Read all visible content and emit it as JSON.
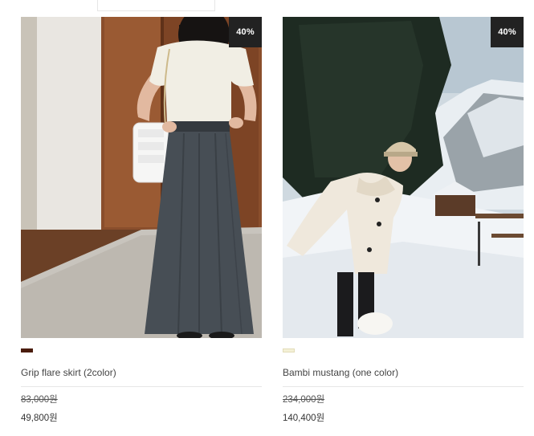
{
  "products": [
    {
      "name": "Grip flare skirt (2color)",
      "discount": "40%",
      "price_original": "83,000원",
      "price_sale": "49,800원",
      "swatch_color": "#4a1c0c",
      "image_desc": "skirt-photo"
    },
    {
      "name": "Bambi mustang (one color)",
      "discount": "40%",
      "price_original": "234,000원",
      "price_sale": "140,400원",
      "swatch_color": "#f4f0d6",
      "image_desc": "mustang-photo"
    }
  ]
}
